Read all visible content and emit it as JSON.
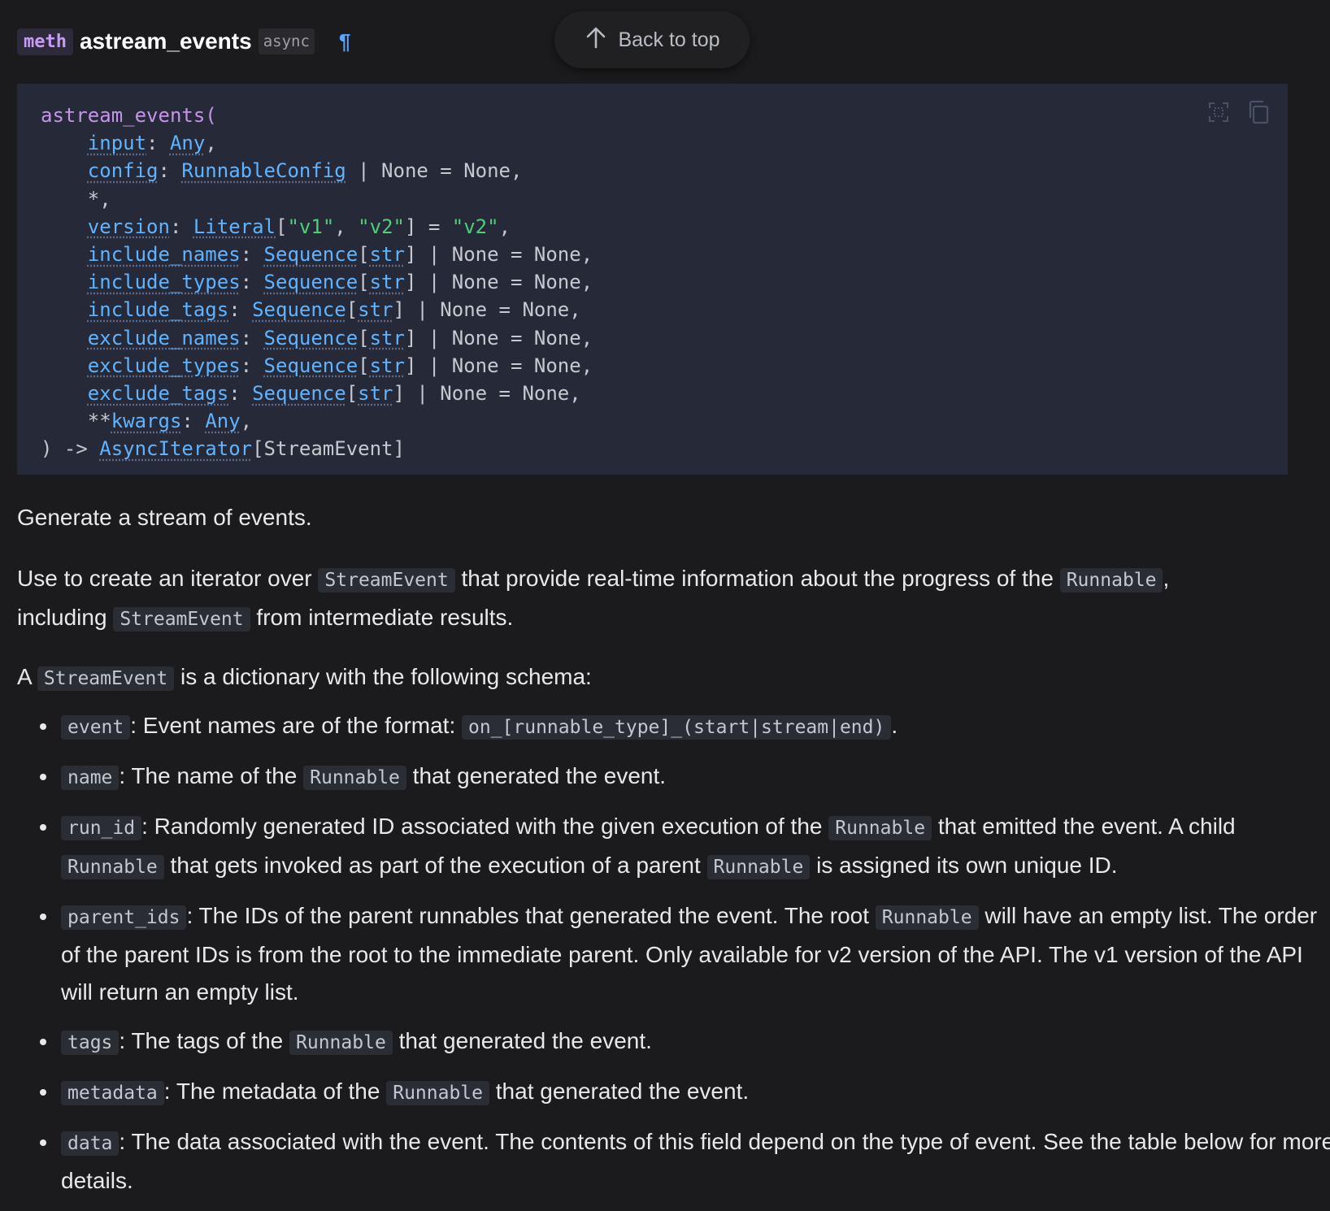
{
  "header": {
    "kind_badge": "meth",
    "method_name": "astream_events",
    "async_badge": "async",
    "permalink_symbol": "¶"
  },
  "back_to_top": {
    "label": "Back to top",
    "icon": "arrow-up-icon"
  },
  "code_toolbar": {
    "icons": [
      "expand-icon",
      "copy-icon"
    ]
  },
  "signature": {
    "l1_name": "astream_events",
    "l1_paren": "(",
    "l2_p": "input",
    "l2_sep": ": ",
    "l2_t": "Any",
    "l2_tail": ",",
    "l3_p": "config",
    "l3_sep": ": ",
    "l3_t": "RunnableConfig",
    "l3_tail": " | None = None,",
    "l4_text": "*,",
    "l5_p": "version",
    "l5_sep": ": ",
    "l5_t": "Literal",
    "l5_a": "[",
    "l5_s1": "\"v1\"",
    "l5_c": ", ",
    "l5_s2": "\"v2\"",
    "l5_b": "] = ",
    "l5_s3": "\"v2\"",
    "l5_tail": ",",
    "params_seq": [
      {
        "p": "include_names",
        "sep": ": ",
        "t": "Sequence",
        "o": "[",
        "str": "str",
        "tail": "] | None = None,"
      },
      {
        "p": "include_types",
        "sep": ": ",
        "t": "Sequence",
        "o": "[",
        "str": "str",
        "tail": "] | None = None,"
      },
      {
        "p": "include_tags",
        "sep": ": ",
        "t": "Sequence",
        "o": "[",
        "str": "str",
        "tail": "] | None = None,"
      },
      {
        "p": "exclude_names",
        "sep": ": ",
        "t": "Sequence",
        "o": "[",
        "str": "str",
        "tail": "] | None = None,"
      },
      {
        "p": "exclude_types",
        "sep": ": ",
        "t": "Sequence",
        "o": "[",
        "str": "str",
        "tail": "] | None = None,"
      },
      {
        "p": "exclude_tags",
        "sep": ": ",
        "t": "Sequence",
        "o": "[",
        "str": "str",
        "tail": "] | None = None,"
      }
    ],
    "l12_stars": "**",
    "l12_p": "kwargs",
    "l12_sep": ": ",
    "l12_t": "Any",
    "l12_tail": ",",
    "l13_head": ") -> ",
    "l13_t": "AsyncIterator",
    "l13_tail": "[StreamEvent]"
  },
  "content": {
    "summary": "Generate a stream of events.",
    "p2_a": "Use to create an iterator over ",
    "p2_c1": "StreamEvent",
    "p2_b": " that provide real-time information about the progress of the ",
    "p2_c2": "Runnable",
    "p2_c": ",",
    "p2_d": "including ",
    "p2_c3": "StreamEvent",
    "p2_e": " from intermediate results.",
    "p3_a": "A ",
    "p3_c1": "StreamEvent",
    "p3_b": " is a dictionary with the following schema:"
  },
  "schema_items": {
    "event": {
      "key": "event",
      "a": ": Event names are of the format: ",
      "code": "on_[runnable_type]_(start|stream|end)",
      "b": "."
    },
    "name": {
      "key": "name",
      "a": ": The name of the ",
      "code": "Runnable",
      "b": " that generated the event."
    },
    "run_id": {
      "key": "run_id",
      "a": ": Randomly generated ID associated with the given execution of the ",
      "code1": "Runnable",
      "b": " that emitted the event. A child ",
      "code2": "Runnable",
      "c": " that gets invoked as part of the execution of a parent ",
      "code3": "Runnable",
      "d": " is assigned its own unique ID."
    },
    "parent_ids": {
      "key": "parent_ids",
      "a": ": The IDs of the parent runnables that generated the event. The root ",
      "code": "Runnable",
      "b": " will have an empty list. The order of the parent IDs is from the root to the immediate parent. Only available for v2 version of the API. The v1 version of the API will return an empty list."
    },
    "tags": {
      "key": "tags",
      "a": ": The tags of the ",
      "code": "Runnable",
      "b": " that generated the event."
    },
    "metadata": {
      "key": "metadata",
      "a": ": The metadata of the ",
      "code": "Runnable",
      "b": " that generated the event."
    },
    "data": {
      "key": "data",
      "a": ": The data associated with the event. The contents of this field depend on the type of event. See the table below for more details."
    }
  }
}
